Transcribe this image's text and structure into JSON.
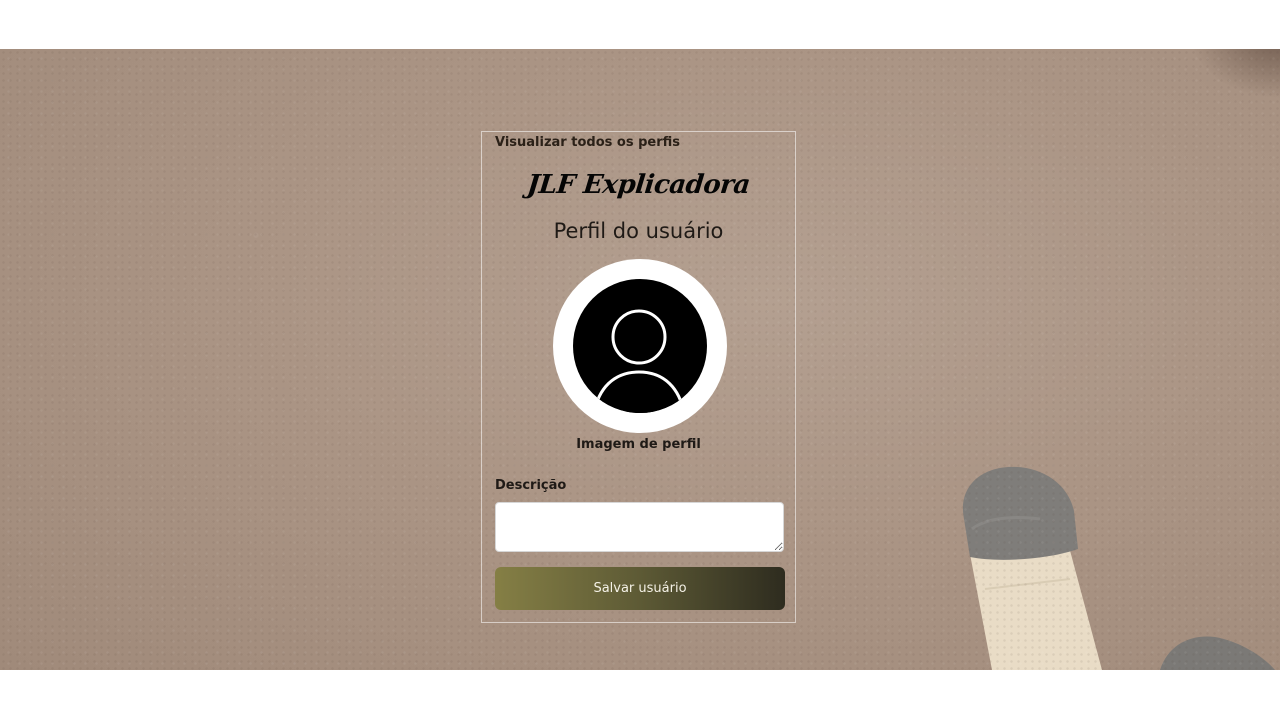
{
  "nav": {
    "view_all_profiles": "Visualizar todos os perfis"
  },
  "brand": {
    "name": "JLF Explicadora"
  },
  "header": {
    "title": "Perfil do usuário"
  },
  "profile": {
    "image_caption": "Imagem de perfil",
    "avatar_icon": "user-avatar-icon"
  },
  "form": {
    "description_label": "Descrição",
    "description_value": "",
    "save_button_label": "Salvar usuário"
  },
  "colors": {
    "background": "#ab9585",
    "button_gradient_start": "#857f45",
    "button_gradient_end": "#2e2c1f",
    "text": "#1f1a16"
  }
}
